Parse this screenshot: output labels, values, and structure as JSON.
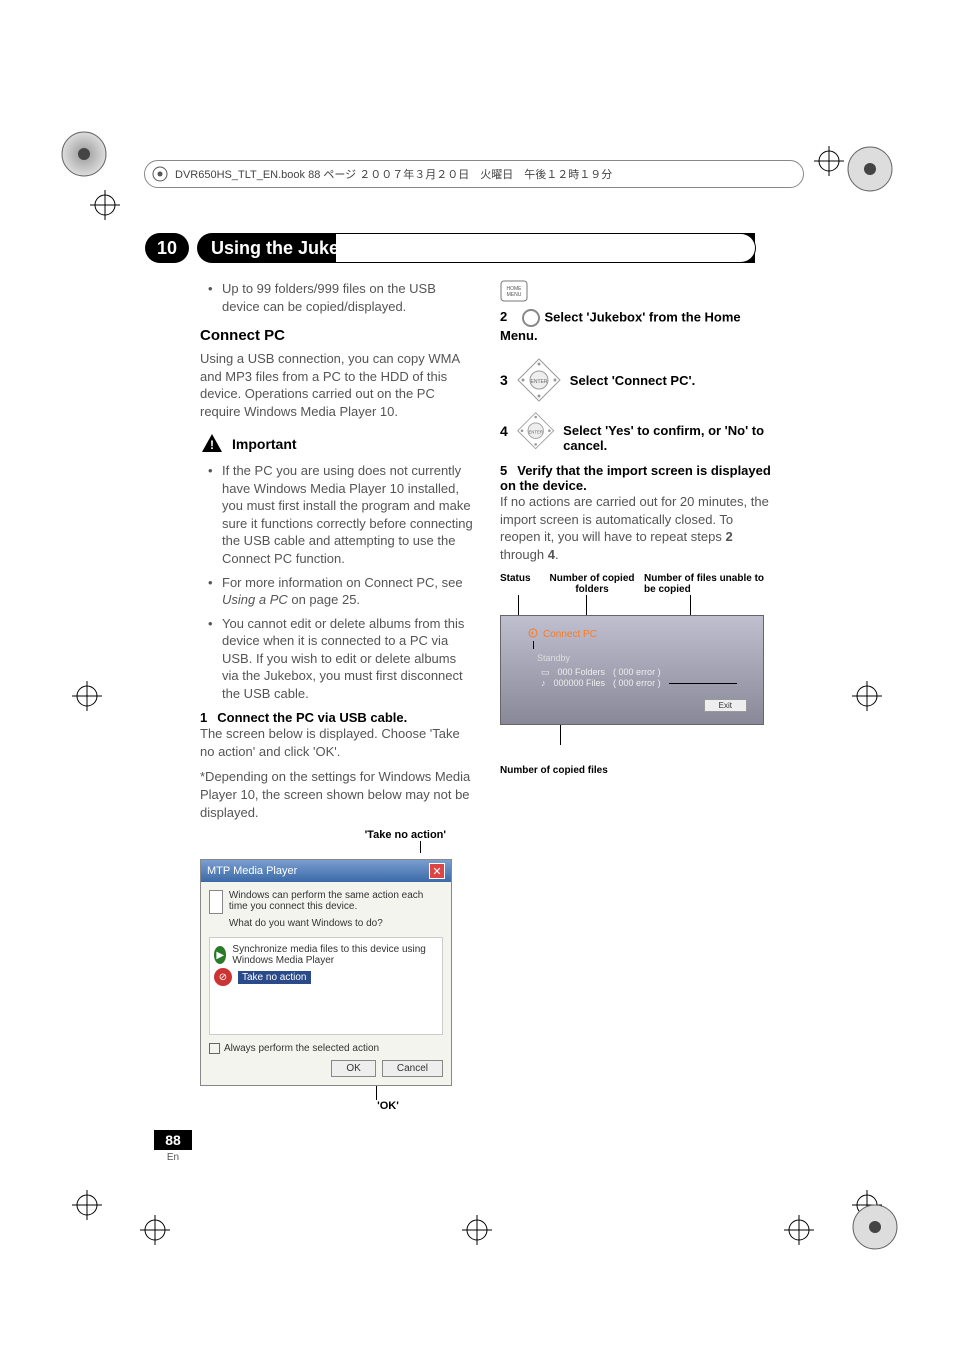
{
  "header": {
    "file_info": "DVR650HS_TLT_EN.book  88 ページ  ２００７年３月２０日　火曜日　午後１２時１９分"
  },
  "chapter": {
    "number": "10",
    "title": "Using the Jukebox"
  },
  "col1": {
    "top_bullet": "Up to 99 folders/999 files on the USB device can be copied/displayed.",
    "connect_pc_heading": "Connect PC",
    "connect_pc_body": "Using a USB connection, you can copy WMA and MP3 files from a PC to the HDD of this device. Operations carried out on the PC require Windows Media Player 10.",
    "important_label": "Important",
    "important_items": [
      "If the PC you are using does not currently have Windows Media Player 10 installed, you must first install the program and make sure it functions correctly before connecting the USB cable and attempting to use the Connect PC function.",
      "For more information on Connect PC, see Using a PC on page 25.",
      "You cannot edit or delete albums from this device when it is connected to a PC via USB. If you wish to edit or delete albums via the Jukebox, you must first disconnect the USB cable."
    ],
    "important_items_italic_phrase": "Using a PC",
    "step1_label": "1",
    "step1_text": "Connect the PC via USB cable.",
    "step1_body": "The screen below is displayed. Choose 'Take no action' and click 'OK'.",
    "step1_note": "*Depending on the settings for Windows Media Player 10, the screen shown below may not be displayed.",
    "fig1": {
      "top_label": "'Take no action'",
      "titlebar": "MTP Media Player",
      "line1": "Windows can perform the same action each time you connect this device.",
      "line2": "What do you want Windows to do?",
      "opt1": "Synchronize media files to this device using Windows Media Player",
      "opt2": "Take no action",
      "checkbox": "Always perform the selected action",
      "ok": "OK",
      "cancel": "Cancel",
      "bottom_label": "'OK'"
    }
  },
  "col2": {
    "step2_num": "2",
    "step2_text_prefix": "Select 'Jukebox' from the Home Menu.",
    "step3_num": "3",
    "step3_text": "Select 'Connect PC'.",
    "step4_num": "4",
    "step4_text": "Select 'Yes' to confirm, or 'No' to cancel.",
    "step5_num": "5",
    "step5_heading": "Verify that the import screen is displayed on the device.",
    "step5_body_a": "If no actions are carried out for 20 minutes, the import screen is automatically closed. To reopen it, you will have to repeat steps ",
    "step5_body_b": " through ",
    "step5_bold2": "2",
    "step5_bold4": "4",
    "step5_body_c": ".",
    "fig2_labels": {
      "status": "Status",
      "copied": "Number of copied folders",
      "unable": "Number of files unable to be copied"
    },
    "fig2": {
      "title": "Connect PC",
      "standby": "Standby",
      "folders_a": "000 Folders",
      "folders_b": "( 000  error )",
      "files_a": "000000 Files",
      "files_b": "( 000  error )",
      "exit": "Exit"
    },
    "fig2_caption": "Number of copied files"
  },
  "page": {
    "number": "88",
    "lang": "En"
  },
  "icons": {
    "home_menu": "HOME MENU",
    "enter": "ENTER"
  }
}
